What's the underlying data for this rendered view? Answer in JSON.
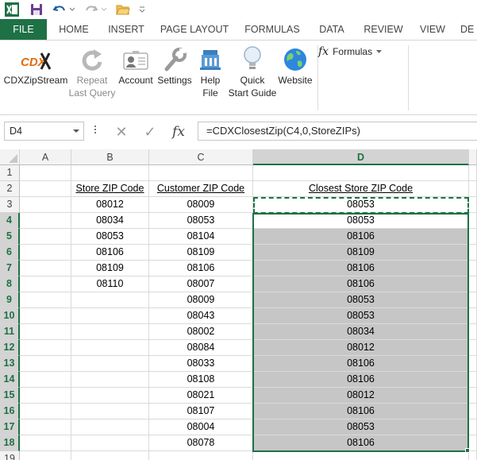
{
  "quick_access": {
    "excel_icon": "excel-logo-icon",
    "save_icon": "save-icon",
    "undo_icon": "undo-icon",
    "redo_icon": "redo-icon",
    "open_icon": "folder-open-icon",
    "customize_icon": "customize-toolbar-icon"
  },
  "tabs": [
    "FILE",
    "HOME",
    "INSERT",
    "PAGE LAYOUT",
    "FORMULAS",
    "DATA",
    "REVIEW",
    "VIEW",
    "DE"
  ],
  "ribbon": {
    "cdx_logo_text": "CDX",
    "cdxzipstream": "CDXZipStream",
    "repeat_line1": "Repeat",
    "repeat_line2": "Last Query",
    "account": "Account",
    "settings": "Settings",
    "help_line1": "Help",
    "help_line2": "File",
    "quick_line1": "Quick",
    "quick_line2": "Start Guide",
    "website": "Website",
    "formulas_label": "Formulas",
    "fx_glyph": "fx"
  },
  "formula_bar": {
    "name_box": "D4",
    "formula": "=CDXClosestZip(C4,0,StoreZIPs)",
    "cancel_glyph": "✕",
    "enter_glyph": "✓",
    "fx_glyph": "fx"
  },
  "columns": [
    "A",
    "B",
    "C",
    "D"
  ],
  "rows": [
    "1",
    "2",
    "3",
    "4",
    "5",
    "6",
    "7",
    "8",
    "9",
    "10",
    "11",
    "12",
    "13",
    "14",
    "15",
    "16",
    "17",
    "18",
    "19"
  ],
  "headers": {
    "store": "Store ZIP Code",
    "customer": "Customer ZIP Code",
    "closest": "Closest Store ZIP Code"
  },
  "store_zips": [
    "08012",
    "08034",
    "08053",
    "08106",
    "08109",
    "08110"
  ],
  "customer_zips": [
    "08009",
    "08053",
    "08104",
    "08109",
    "08106",
    "08007",
    "08009",
    "08043",
    "08002",
    "08084",
    "08033",
    "08108",
    "08021",
    "08107",
    "08004",
    "08078"
  ],
  "closest_zips": [
    "08053",
    "08053",
    "08106",
    "08109",
    "08106",
    "08106",
    "08053",
    "08053",
    "08034",
    "08012",
    "08106",
    "08106",
    "08012",
    "08106",
    "08053",
    "08106"
  ],
  "colors": {
    "excel_green": "#1e7145",
    "selection_fill": "#c6c6c6"
  }
}
